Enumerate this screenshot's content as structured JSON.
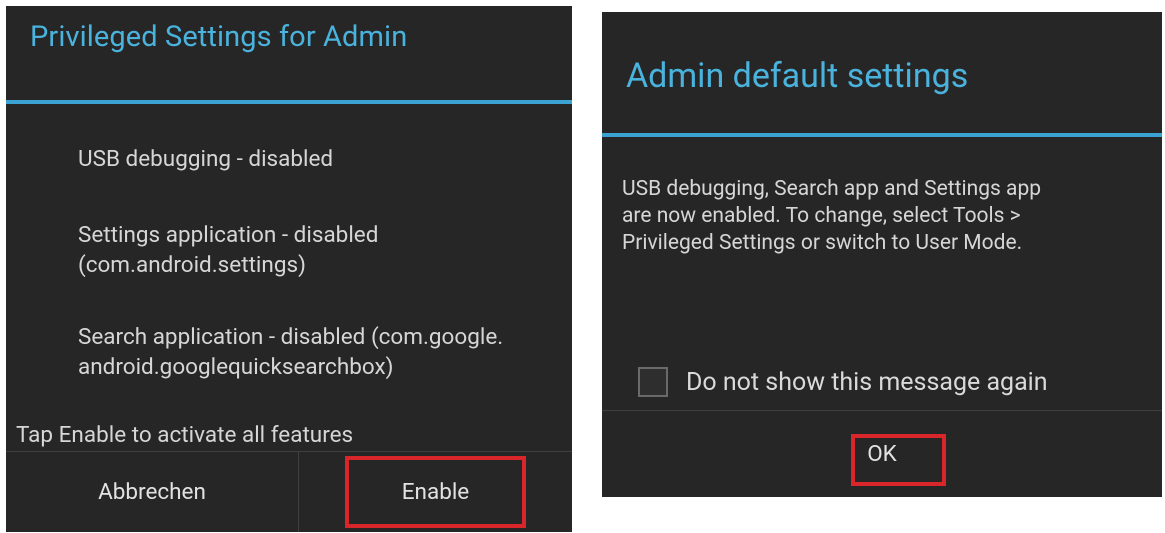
{
  "left_dialog": {
    "title": "Privileged Settings for Admin",
    "items": [
      {
        "line1": "USB debugging - disabled"
      },
      {
        "line1": "Settings application - disabled",
        "line2": "(com.android.settings)"
      },
      {
        "line1": "Search application - disabled (com.google.",
        "line2": "android.googlequicksearchbox)"
      }
    ],
    "hint": "Tap Enable to activate all features",
    "buttons": {
      "cancel": "Abbrechen",
      "enable": "Enable"
    }
  },
  "right_dialog": {
    "title": "Admin default settings",
    "message_lines": [
      "USB debugging, Search app and Settings app",
      "are now enabled. To change, select Tools >",
      "Privileged Settings or switch to User Mode."
    ],
    "checkbox": {
      "label": "Do not show this message again",
      "checked": false
    },
    "ok_button": "OK"
  },
  "colors": {
    "dialog_bg": "#262626",
    "title_blue": "#4ab3dd",
    "divider_blue": "#3aa3d4",
    "highlight_red": "#d8262a",
    "text": "#d6d6d6"
  }
}
